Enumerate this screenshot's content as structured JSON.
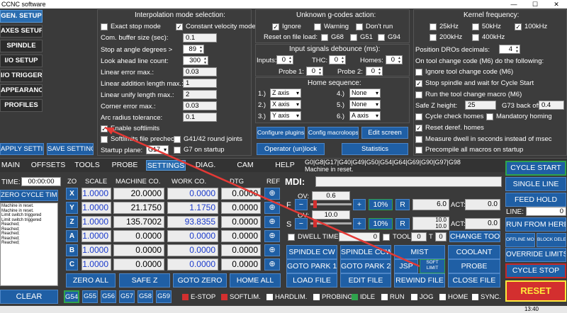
{
  "window": {
    "title": "CCNC software",
    "min": "—",
    "max": "☐",
    "close": "✕"
  },
  "left_menu": [
    {
      "label": "GEN. SETUP"
    },
    {
      "label": "AXES SETUP"
    },
    {
      "label": "SPINDLE"
    },
    {
      "label": "I/O SETUP"
    },
    {
      "label": "I/O TRIGGER"
    },
    {
      "label": "APPEARANCE"
    },
    {
      "label": "PROFILES"
    }
  ],
  "apply_settings": "APPLY SETTINGS",
  "save_settings": "SAVE SETTINGS",
  "interp": {
    "title": "Interpolation mode selection:",
    "exact_stop": "Exact stop mode",
    "const_vel": "Constant velocity mode",
    "buffer_label": "Com. buffer size (sec):",
    "buffer_val": "0.1",
    "stop_angle_label": "Stop at angle degrees >",
    "stop_angle_val": "89",
    "lookahead_label": "Look ahead line count:",
    "lookahead_val": "300",
    "lin_err_label": "Linear error max.:",
    "lin_err_val": "0.03",
    "lin_add_label": "Linear addition length max.:",
    "lin_add_val": "1",
    "lin_unify_label": "Linear unify length max.:",
    "lin_unify_val": "2",
    "corner_label": "Corner error max.:",
    "corner_val": "0.03",
    "arc_label": "Arc radius tolerance:",
    "arc_val": "0.1",
    "softlimits": "Enable softlimits",
    "softlimits_pre": "Softlimits file precheck",
    "g41": "G41/42 round joints",
    "startup_plane_label": "Startup plane:",
    "startup_plane_val": "G17",
    "g7": "G7 on startup"
  },
  "gcode": {
    "title": "Unknown g-codes action:",
    "ignore": "Ignore",
    "warning": "Warning",
    "dont_run": "Don't run",
    "reset_label": "Reset on file load:",
    "g68": "G68",
    "g51": "G51",
    "g94": "G94"
  },
  "debounce": {
    "title": "Input signals debounce (ms):",
    "inputs": "Inputs:",
    "inputs_val": "0",
    "thc": "THC:",
    "thc_val": "0",
    "homes": "Homes:",
    "homes_val": "0",
    "probe1": "Probe 1:",
    "probe1_val": "0",
    "probe2": "Probe 2:",
    "probe2_val": "0"
  },
  "home_seq": {
    "title": "Home sequence:",
    "rows": [
      {
        "n": "1.)",
        "v": "Z axis"
      },
      {
        "n": "2.)",
        "v": "X axis"
      },
      {
        "n": "3.)",
        "v": "Y axis"
      },
      {
        "n": "4.)",
        "v": "None"
      },
      {
        "n": "5.)",
        "v": "None"
      },
      {
        "n": "6.)",
        "v": "A axis"
      }
    ]
  },
  "mid_buttons": {
    "config_plugins": "Configure plugins",
    "config_macro": "Config macroloops",
    "edit_screen": "Edit screen",
    "operator": "Operator (un)lock",
    "statistics": "Statistics"
  },
  "kernel": {
    "title": "Kernel frequency:",
    "f25": "25kHz",
    "f50": "50kHz",
    "f100": "100kHz",
    "f200": "200kHz",
    "f400": "400kHz",
    "dro_label": "Position DROs decimals:",
    "dro_val": "4",
    "tool_change_label": "On tool change code (M6) do the following:",
    "ignore_tc": "Ignore tool change code (M6)",
    "stop_spindle": "Stop spindle and wait for Cycle Start",
    "run_macro": "Run the tool change macro (M6)",
    "safe_z_label": "Safe Z height:",
    "safe_z_val": "25",
    "g73_label": "G73 back off:",
    "g73_val": "0.4",
    "cycle_check": "Cycle check homes",
    "mand_homing": "Mandatory homing",
    "reset_deref": "Reset deref. homes",
    "measure_dwell": "Measure dwell in seconds instead of msec",
    "precompile": "Precompile all macros on startup"
  },
  "tabs": [
    "MAIN",
    "OFFSETS",
    "TOOLS",
    "PROBE",
    "SETTINGS",
    "DIAG.",
    "CAM",
    "HELP"
  ],
  "gcode_status": "G0|G8|G17|G40|G49|G50|G54|G64|G69|G90|G97|G98",
  "machine_status": "Machine in reset.",
  "time_label": "TIME:",
  "time_val": "00:00:00",
  "zero_cycle": "ZERO CYCLE TIME",
  "log": [
    "Machine in reset.",
    "Machine in reset.",
    "Limit switch triggered",
    "Limit switch triggered",
    "Reached;",
    "Reached;",
    "Reached;",
    "Reached;",
    "Reached;"
  ],
  "clear": "CLEAR",
  "dro_headers": {
    "zo": "ZO",
    "scale": "SCALE",
    "machine": "MACHINE CO.",
    "work": "WORK CO.",
    "dtg": "DTG",
    "ref": "REF"
  },
  "axes": [
    {
      "n": "X",
      "scale": "1.0000",
      "m": "20.0000",
      "w": "0.0000",
      "d": "0.0000"
    },
    {
      "n": "Y",
      "scale": "1.0000",
      "m": "21.1750",
      "w": "1.1750",
      "d": "0.0000"
    },
    {
      "n": "Z",
      "scale": "1.0000",
      "m": "135.7002",
      "w": "93.8355",
      "d": "0.0000"
    },
    {
      "n": "A",
      "scale": "1.0000",
      "m": "0.0000",
      "w": "0.0000",
      "d": "0.0000"
    },
    {
      "n": "B",
      "scale": "1.0000",
      "m": "0.0000",
      "w": "0.0000",
      "d": "0.0000"
    },
    {
      "n": "C",
      "scale": "1.0000",
      "m": "0.0000",
      "w": "0.0000",
      "d": "0.0000"
    }
  ],
  "ref_icon": "⊕",
  "zero_all": "ZERO ALL",
  "safe_z": "SAFE Z",
  "goto_zero": "GOTO ZERO",
  "home_all": "HOME ALL",
  "mdi": "MDI:",
  "feed": {
    "ov": "OV:",
    "ov_val": "0.6",
    "label": "F",
    "pct": "10%",
    "r": "R",
    "val": "6.0",
    "act": "ACT:",
    "act_val": "0.0"
  },
  "speed": {
    "ov": "OV:",
    "ov_val": "10.0",
    "label": "S",
    "pct": "10%",
    "r": "R",
    "val_top": "10.0",
    "val": "10.0",
    "act": "ACT:",
    "act_val": "0.0"
  },
  "dwell": "DWELL TIME:",
  "dwell_val": "0",
  "tool": "TOOL:",
  "tool_val": "0",
  "t": "T",
  "t_val": "0",
  "change_tool": "CHANGE TOOL",
  "spindle_cw": "SPINDLE CW",
  "spindle_ccw": "SPINDLE CCW",
  "mist": "MIST",
  "coolant": "COOLANT",
  "goto_park1": "GOTO PARK 1",
  "goto_park2": "GOTO PARK 2",
  "jsp": "JSP",
  "soft_limit": "SOFT LIMIT",
  "probe": "PROBE",
  "load_file": "LOAD FILE",
  "edit_file": "EDIT FILE",
  "rewind_file": "REWIND FILE",
  "close_file": "CLOSE FILE",
  "right": {
    "cycle_start": "CYCLE START",
    "single_line": "SINGLE LINE",
    "feed_hold": "FEED HOLD",
    "line": "LINE:",
    "line_val": "0",
    "run_from_here": "RUN FROM HERE",
    "offline": "OFFLINE MODE",
    "block_delete": "BLOCK DELETE",
    "override": "OVERRIDE LIMITS",
    "cycle_stop": "CYCLE STOP",
    "reset": "RESET"
  },
  "work_offsets": [
    "G54",
    "G55",
    "G56",
    "G57",
    "G58",
    "G59"
  ],
  "status_leds": [
    {
      "label": "E-STOP",
      "color": "#d32f2f"
    },
    {
      "label": "SOFTLIM.",
      "color": "#d32f2f"
    },
    {
      "label": "HARDLIM.",
      "color": "#ffffff"
    },
    {
      "label": "PROBING",
      "color": "#ffffff"
    },
    {
      "label": "IDLE",
      "color": "#2fa34d"
    },
    {
      "label": "RUN",
      "color": "#ffffff"
    },
    {
      "label": "JOG",
      "color": "#ffffff"
    },
    {
      "label": "HOME",
      "color": "#ffffff"
    },
    {
      "label": "SYNC.",
      "color": "#ffffff"
    }
  ],
  "taskbar": {
    "time": "13:40"
  }
}
